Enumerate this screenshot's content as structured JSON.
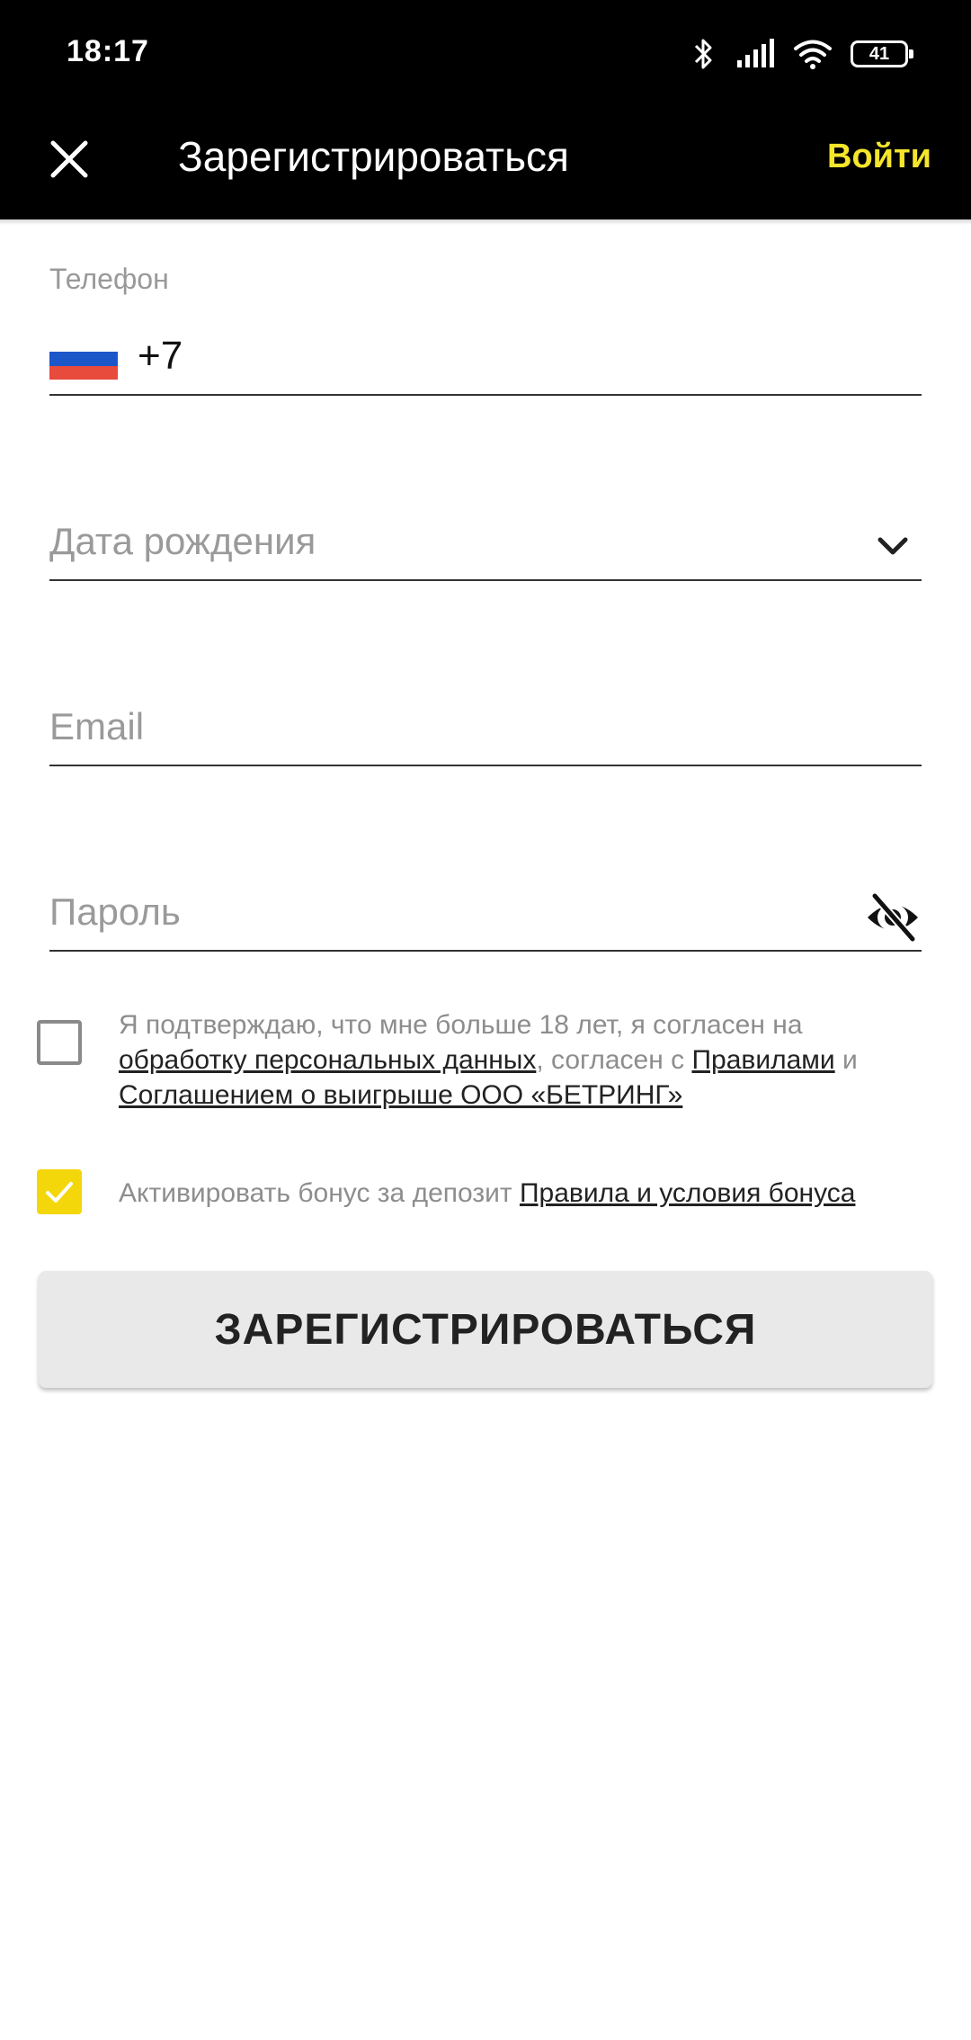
{
  "status_bar": {
    "time": "18:17",
    "battery": "41",
    "icons": [
      "bluetooth-icon",
      "signal-icon",
      "wifi-icon",
      "battery-icon"
    ]
  },
  "app_bar": {
    "title": "Зарегистрироваться",
    "login_label": "Войти",
    "close_icon": "close-icon"
  },
  "colors": {
    "accent": "#f5e52b",
    "checkbox_checked": "#f4d70a",
    "header_bg": "#000000"
  },
  "form": {
    "phone": {
      "label": "Телефон",
      "value": "+7",
      "country_flag": "russia-flag-icon"
    },
    "birthdate": {
      "placeholder": "Дата рождения"
    },
    "email": {
      "placeholder": "Email"
    },
    "password": {
      "placeholder": "Пароль"
    },
    "consent": {
      "checked": false,
      "text_1": "Я подтверждаю, что мне больше 18 лет, я согласен на ",
      "link_1": "обработку персональных данных",
      "text_2": ", согласен с ",
      "link_2": "Правилами",
      "text_3": " и ",
      "link_3": "Соглашением о выигрыше ООО «БЕТРИНГ»"
    },
    "bonus": {
      "checked": true,
      "text": "Активировать бонус за депозит ",
      "link": "Правила и условия бонуса"
    },
    "submit_label": "ЗАРЕГИСТРИРОВАТЬСЯ"
  }
}
